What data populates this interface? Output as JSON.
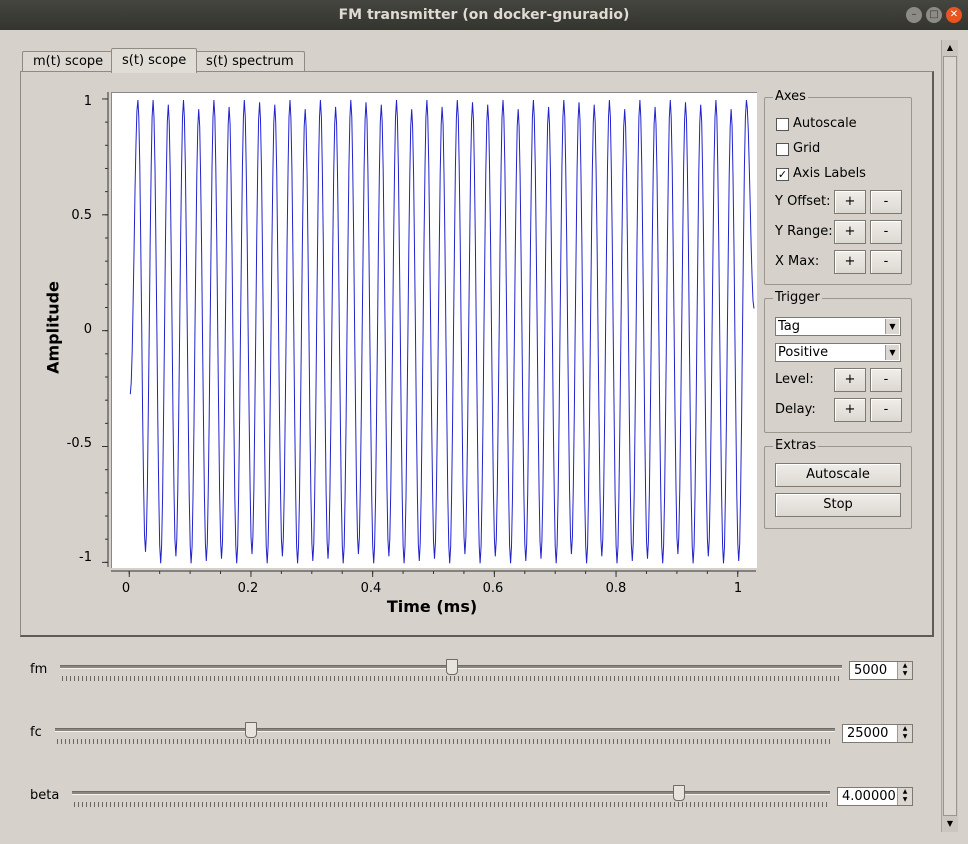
{
  "window": {
    "title": "FM transmitter (on docker-gnuradio)"
  },
  "tabs": [
    {
      "label": "m(t) scope"
    },
    {
      "label": "s(t) scope"
    },
    {
      "label": "s(t) spectrum"
    }
  ],
  "chart_data": {
    "type": "line",
    "xlabel": "Time (ms)",
    "ylabel": "Amplitude",
    "xlim": [
      -0.03,
      1.03
    ],
    "ylim": [
      -1.02,
      1.03
    ],
    "xticks": [
      "0",
      "0.2",
      "0.4",
      "0.6",
      "0.8",
      "1"
    ],
    "yticks": [
      "1",
      "0.5",
      "0",
      "-0.5",
      "-1"
    ],
    "grid": false,
    "series": [
      {
        "color": "#2222cc",
        "x": [
          0,
          0.0125,
          0.025,
          0.0375,
          0.05,
          0.0625,
          0.075,
          0.0875,
          0.1,
          0.1125,
          0.125,
          0.1375,
          0.15,
          0.1625,
          0.175,
          0.1875,
          0.2,
          0.2125,
          0.225,
          0.2375,
          0.25,
          0.2625,
          0.275,
          0.2875,
          0.3,
          0.3125,
          0.325,
          0.3375,
          0.35,
          0.3625,
          0.375,
          0.3875,
          0.4,
          0.4125,
          0.425,
          0.4375,
          0.45,
          0.4625,
          0.475,
          0.4875,
          0.5,
          0.5125,
          0.525,
          0.5375,
          0.55,
          0.5625,
          0.575,
          0.5875,
          0.6,
          0.6125,
          0.625,
          0.6375,
          0.65,
          0.6625,
          0.675,
          0.6875,
          0.7,
          0.7125,
          0.725,
          0.7375,
          0.75,
          0.7625,
          0.775,
          0.7875,
          0.8,
          0.8125,
          0.825,
          0.8375,
          0.85,
          0.8625,
          0.875,
          0.8875,
          0.9,
          0.9125,
          0.925,
          0.9375,
          0.95,
          0.9625,
          0.975,
          0.9875,
          1.0,
          1.0125,
          1.025
        ],
        "y": [
          -0.27,
          1.0,
          -0.95,
          1.0,
          -1.0,
          0.98,
          -0.97,
          1.0,
          -1.0,
          0.96,
          -0.99,
          1.0,
          -0.98,
          0.97,
          -1.0,
          1.0,
          -0.96,
          0.99,
          -1.0,
          0.98,
          -0.97,
          1.0,
          -1.0,
          0.96,
          -0.99,
          1.0,
          -0.98,
          0.97,
          -1.0,
          1.0,
          -0.96,
          0.99,
          -1.0,
          0.98,
          -0.97,
          1.0,
          -1.0,
          0.96,
          -0.99,
          1.0,
          -0.98,
          0.97,
          -1.0,
          1.0,
          -0.96,
          0.99,
          -1.0,
          0.98,
          -0.97,
          1.0,
          -1.0,
          0.96,
          -0.99,
          1.0,
          -0.98,
          0.97,
          -1.0,
          1.0,
          -0.96,
          0.99,
          -1.0,
          0.98,
          -0.97,
          1.0,
          -1.0,
          0.96,
          -0.99,
          1.0,
          -0.98,
          0.97,
          -1.0,
          1.0,
          -0.96,
          0.99,
          -1.0,
          0.98,
          -0.97,
          1.0,
          -1.0,
          0.96,
          -0.99,
          1.0,
          0.1
        ]
      }
    ]
  },
  "axes_panel": {
    "title": "Axes",
    "autoscale": {
      "label": "Autoscale",
      "checked": false,
      "mark": ""
    },
    "grid": {
      "label": "Grid",
      "checked": false,
      "mark": ""
    },
    "axis_labels": {
      "label": "Axis Labels",
      "checked": true,
      "mark": "✓"
    },
    "y_offset": {
      "label": "Y Offset:"
    },
    "y_range": {
      "label": "Y Range:"
    },
    "x_max": {
      "label": "X Max:"
    },
    "plus": "+",
    "minus": "-"
  },
  "trigger_panel": {
    "title": "Trigger",
    "mode": "Tag",
    "slope": "Positive",
    "level": {
      "label": "Level:"
    },
    "delay": {
      "label": "Delay:"
    }
  },
  "extras_panel": {
    "title": "Extras",
    "autoscale_button": "Autoscale",
    "stop_button": "Stop"
  },
  "sliders": [
    {
      "label": "fm",
      "value": "5000",
      "level": 0.5
    },
    {
      "label": "fc",
      "value": "25000",
      "level": 0.25
    },
    {
      "label": "beta",
      "value": "4.00000",
      "level": 0.8
    }
  ]
}
